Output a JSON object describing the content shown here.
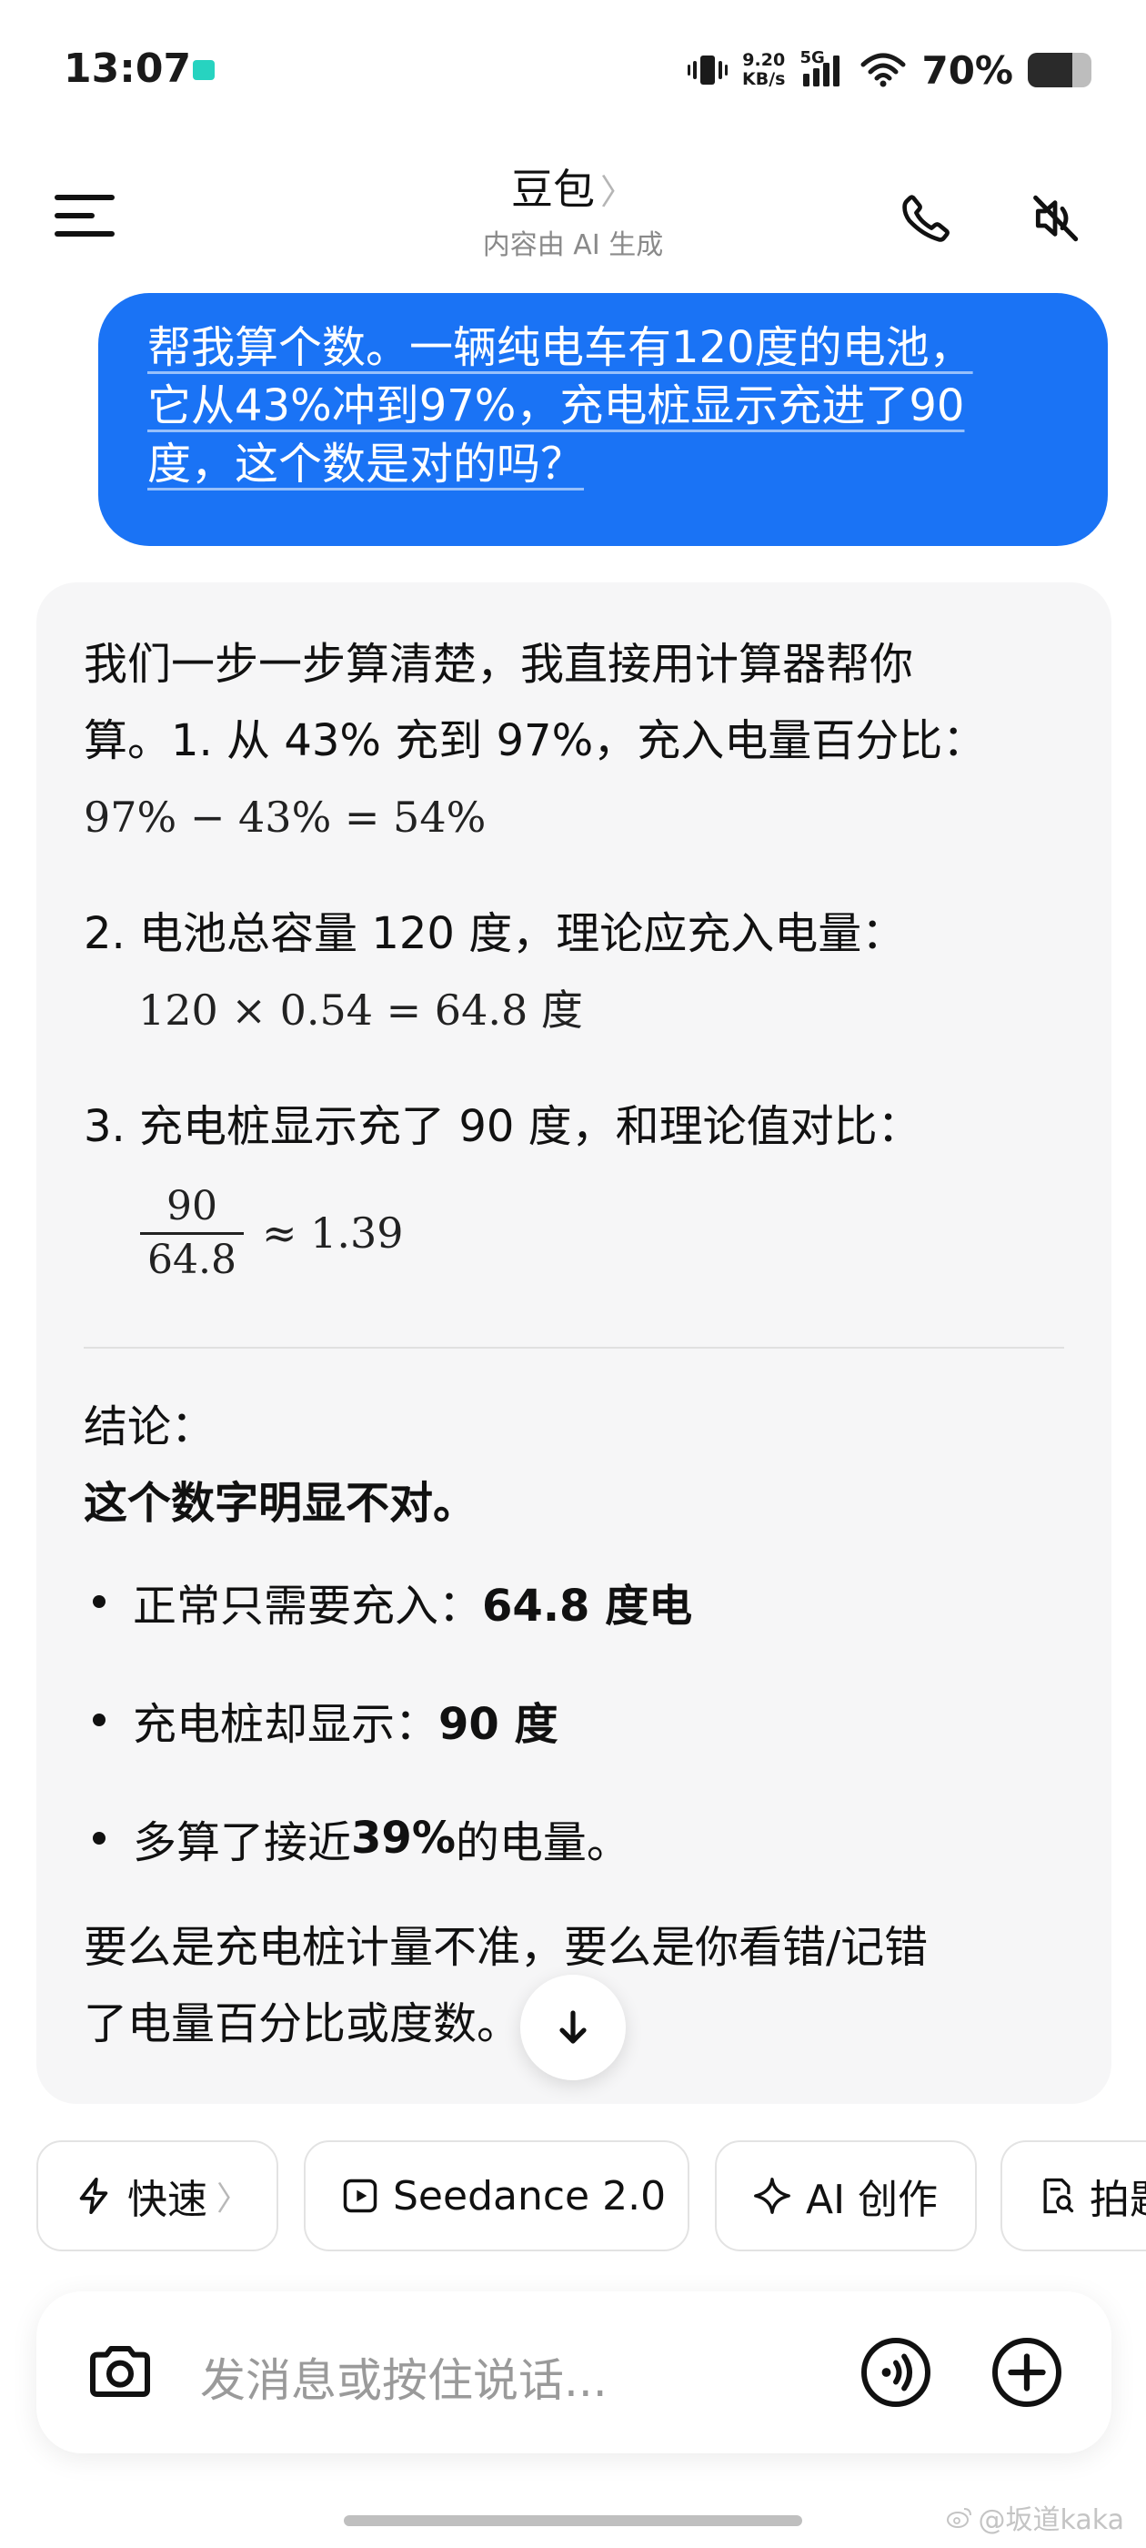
{
  "status_bar": {
    "time": "13:07",
    "net_speed_value": "9.20",
    "net_speed_unit": "KB/s",
    "network_type": "5G",
    "battery_text": "70%",
    "battery_level": 0.7
  },
  "header": {
    "title": "豆包",
    "title_chevron": "〉",
    "subtitle": "内容由 AI 生成",
    "icons": [
      "menu-icon",
      "phone-icon",
      "mute-icon"
    ]
  },
  "user_message": {
    "lines": [
      "帮我算个数。一辆纯电车有120度的电池，",
      "它从43%冲到97%，充电桩显示充进了90",
      "度，这个数是对的吗？"
    ]
  },
  "answer": {
    "intro_line1": "我们一步一步算清楚，我直接用计算器帮你",
    "intro_line2": "算。1. 从 43% 充到 97%，充入电量百分比：",
    "eq1": "97% − 43% = 54%",
    "step2": "2. 电池总容量 120 度，理论应充入电量：",
    "eq2": "120 × 0.54 = 64.8",
    "eq2_unit": "度",
    "step3": "3. 充电桩显示充了 90 度，和理论值对比：",
    "frac_num": "90",
    "frac_den": "64.8",
    "frac_rest": "≈ 1.39",
    "conclusion_label": "结论：",
    "conclusion_bold": "这个数字明显不对。",
    "bullets": [
      {
        "prefix": "正常只需要充入：",
        "bold": "64.8 度电",
        "suffix": ""
      },
      {
        "prefix": "充电桩却显示：",
        "bold": "90 度",
        "suffix": ""
      },
      {
        "prefix": "多算了接近 ",
        "bold": "39%",
        "suffix": " 的电量。"
      }
    ],
    "final_line1": "要么是充电桩计量不准，要么是你看错/记错",
    "final_line2": "了电量百分比或度数。"
  },
  "chips": [
    {
      "label": "快速",
      "icon": "lightning-icon",
      "has_chevron": true
    },
    {
      "label": "Seedance 2.0",
      "icon": "play-icon",
      "has_chevron": false
    },
    {
      "label": "AI 创作",
      "icon": "sparkle-icon",
      "has_chevron": false
    },
    {
      "label": "拍题",
      "icon": "doc-search-icon",
      "has_chevron": false
    }
  ],
  "input": {
    "placeholder": "发消息或按住说话..."
  },
  "watermark": "@坂道kaka",
  "colors": {
    "accent": "#1a73f5",
    "card_bg": "#f6f6f7",
    "subtitle": "#8a8a8a"
  }
}
